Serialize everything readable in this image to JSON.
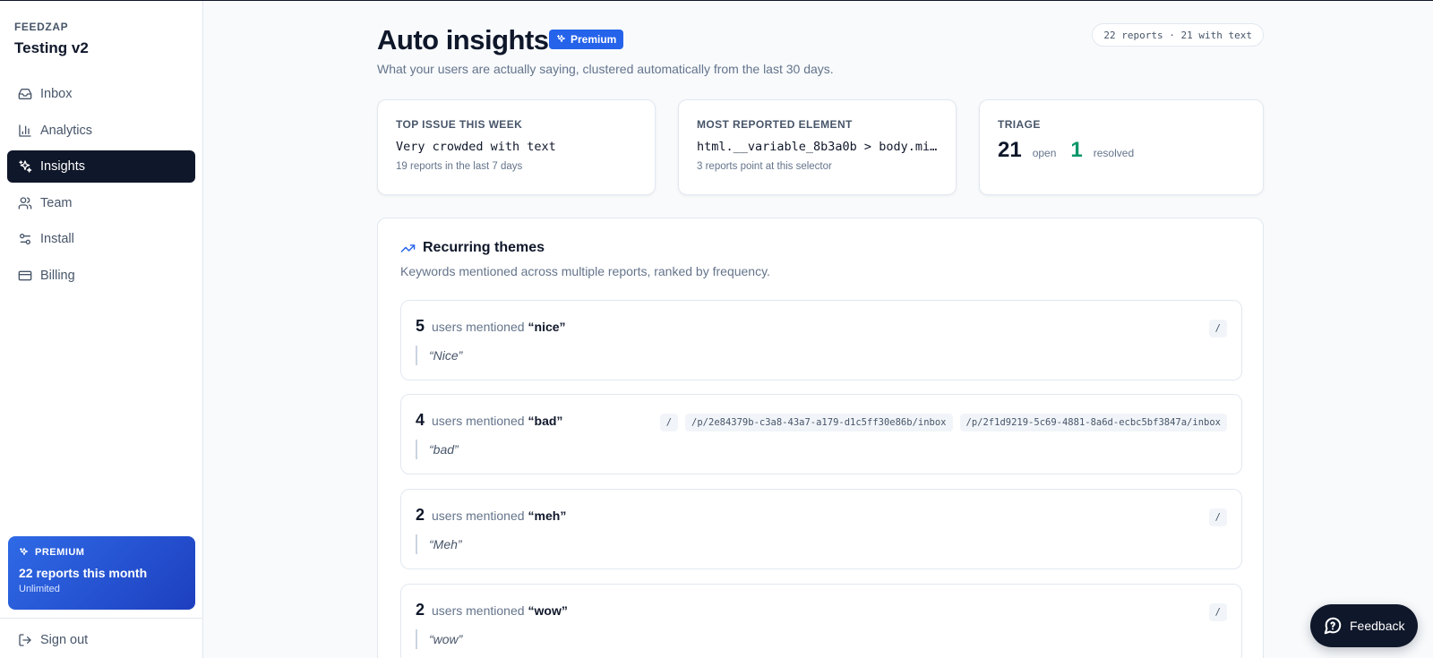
{
  "sidebar": {
    "brand": "FEEDZAP",
    "project": "Testing v2",
    "items": [
      {
        "label": "Inbox",
        "icon": "inbox-icon"
      },
      {
        "label": "Analytics",
        "icon": "bar-chart-icon"
      },
      {
        "label": "Insights",
        "icon": "sparkles-icon",
        "active": true
      },
      {
        "label": "Team",
        "icon": "users-icon"
      },
      {
        "label": "Install",
        "icon": "settings-sliders-icon"
      },
      {
        "label": "Billing",
        "icon": "credit-card-icon"
      }
    ],
    "premium": {
      "tag": "PREMIUM",
      "title": "22 reports this month",
      "sub": "Unlimited"
    },
    "signout": "Sign out"
  },
  "header": {
    "title": "Auto insights",
    "badge": "Premium",
    "subtitle": "What your users are actually saying, clustered automatically from the last 30 days.",
    "count_pill": "22 reports · 21 with text"
  },
  "stats": {
    "top_issue": {
      "label": "TOP ISSUE THIS WEEK",
      "value": "Very crowded with text",
      "sub": "19 reports in the last 7 days"
    },
    "most_reported": {
      "label": "MOST REPORTED ELEMENT",
      "value": "html.__variable_8b3a0b > body.min-…",
      "sub": "3 reports point at this selector"
    },
    "triage": {
      "label": "TRIAGE",
      "open_count": "21",
      "open_label": "open",
      "resolved_count": "1",
      "resolved_label": "resolved"
    }
  },
  "themes": {
    "title": "Recurring themes",
    "subtitle": "Keywords mentioned across multiple reports, ranked by frequency.",
    "mid_text": "users mentioned",
    "items": [
      {
        "count": "5",
        "keyword": "“nice”",
        "quote": "“Nice”",
        "paths": [
          "/"
        ]
      },
      {
        "count": "4",
        "keyword": "“bad”",
        "quote": "“bad”",
        "paths": [
          "/",
          "/p/2e84379b-c3a8-43a7-a179-d1c5ff30e86b/inbox",
          "/p/2f1d9219-5c69-4881-8a6d-ecbc5bf3847a/inbox"
        ]
      },
      {
        "count": "2",
        "keyword": "“meh”",
        "quote": "“Meh”",
        "paths": [
          "/"
        ]
      },
      {
        "count": "2",
        "keyword": "“wow”",
        "quote": "“wow”",
        "paths": [
          "/"
        ]
      }
    ]
  },
  "feedback_button": "Feedback",
  "colors": {
    "accent": "#2563eb",
    "dark": "#0f172a",
    "resolved": "#059669"
  }
}
